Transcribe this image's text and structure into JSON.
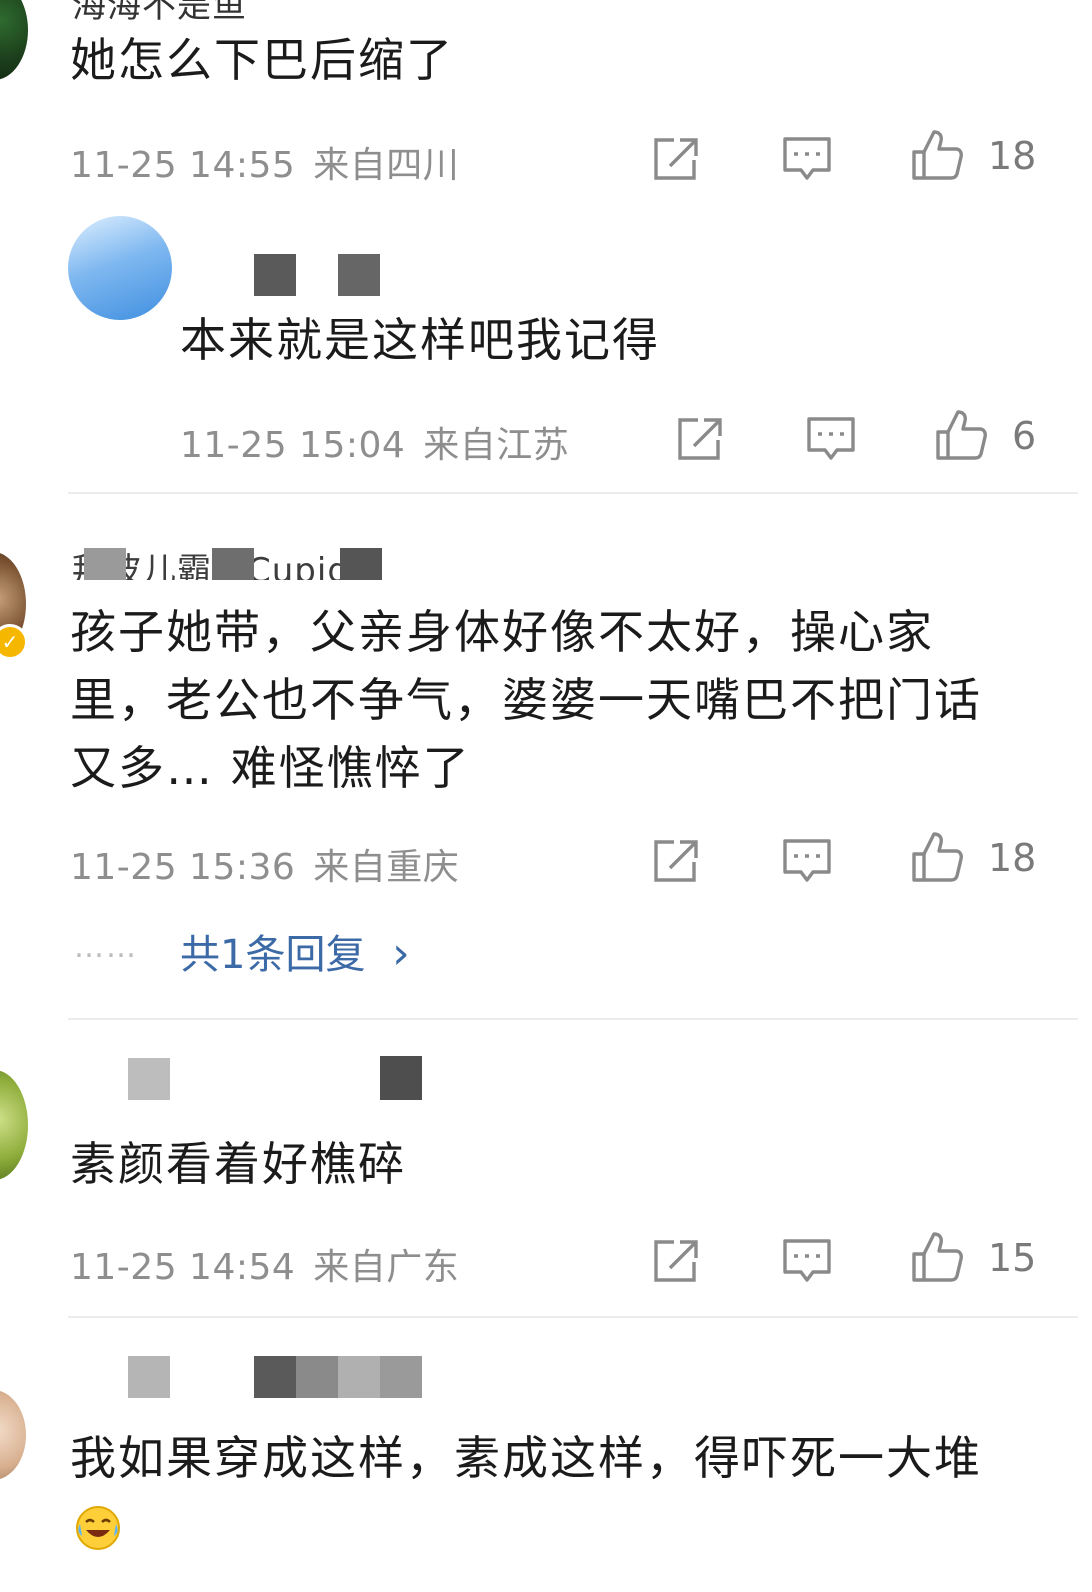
{
  "comments": [
    {
      "username": "海海不是鱼",
      "content": "她怎么下巴后缩了",
      "time": "11-25 14:55",
      "location": "来自四川",
      "likes": "18"
    },
    {
      "username": "",
      "content": "本来就是这样吧我记得",
      "time": "11-25 15:04",
      "location": "来自江苏",
      "likes": "6"
    },
    {
      "username": "拜波儿霸和Cupid",
      "content": "孩子她带，父亲身体好像不太好，操心家里，老公也不争气，婆婆一天嘴巴不把门话又多… 难怪憔悴了",
      "time": "11-25 15:36",
      "location": "来自重庆",
      "likes": "18",
      "replies_dots": "……",
      "replies_label": "共1条回复",
      "replies_arrow": "›"
    },
    {
      "username": "",
      "content": "素颜看着好樵碎",
      "time": "11-25 14:54",
      "location": "来自广东",
      "likes": "15"
    },
    {
      "username": "",
      "content": "我如果穿成这样，素成这样，得吓死一大堆",
      "time": "",
      "location": "",
      "likes": ""
    }
  ],
  "icons": {
    "share": "share-icon",
    "reply": "comment-icon",
    "like": "thumbs-up-icon",
    "verified": "verified-badge-icon",
    "emoji": "laugh-cry-emoji-icon"
  },
  "colors": {
    "link": "#3b6aa6",
    "meta": "#8e8e8e",
    "verified": "#f5b700"
  }
}
